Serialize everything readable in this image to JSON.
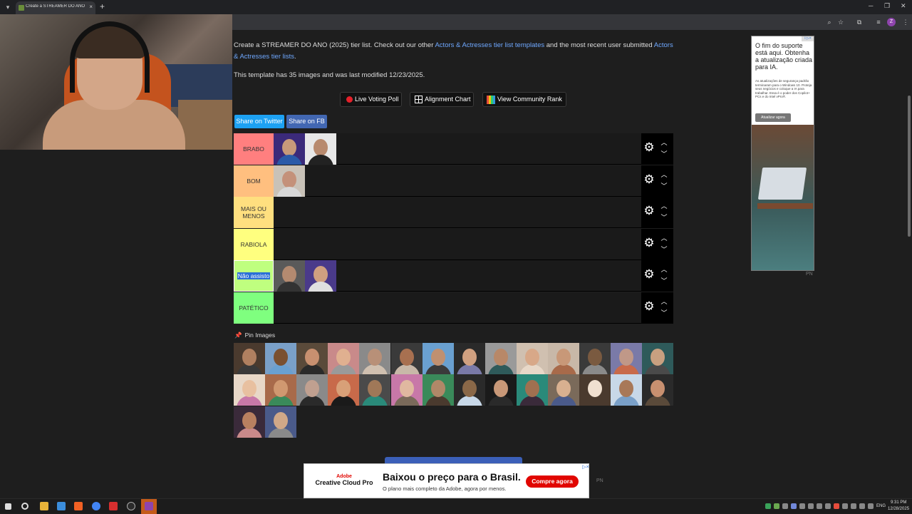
{
  "browser": {
    "tab_title": "Create a STREAMER DO ANO (2025)",
    "new_tab": "+",
    "close_tab": "×"
  },
  "page": {
    "intro_prefix": "Create a STREAMER DO ANO (2025) tier list. Check out our other ",
    "intro_link1": "Actors & Actresses tier list templates",
    "intro_mid": " and the most recent user submitted ",
    "intro_link2": "Actors & Actresses tier lists",
    "intro_suffix": ".",
    "meta": "This template has 35 images and was last modified 12/23/2025."
  },
  "buttons": {
    "live_poll": "Live Voting Poll",
    "alignment": "Alignment Chart",
    "community": "View Community Rank",
    "share_twitter": "Share on Twitter",
    "share_fb": "Share on FB"
  },
  "tiers": [
    {
      "label": "BRABO",
      "color": "#ff7f7f",
      "items": 2
    },
    {
      "label": "BOM",
      "color": "#ffbf7f",
      "items": 1
    },
    {
      "label": "MAIS OU MENOS",
      "color": "#ffdf7f",
      "items": 0
    },
    {
      "label": "RABIOLA",
      "color": "#ffff7f",
      "items": 0
    },
    {
      "label": "Não assisto",
      "color": "#bfff7f",
      "items": 2,
      "selected": true
    },
    {
      "label": "PATÉTICO",
      "color": "#7fff7f",
      "items": 0
    }
  ],
  "pin_label": "Pin Images",
  "pool_count": 30,
  "ad_side": {
    "headline": "O fim do suporte está aqui. Obtenha a atualização criada para IA.",
    "body": "As atualizações de segurança padrão terminaram para o Windows 10. Proteja seus negócios e coloque a IA para trabalhar. Essa é o poder dos Copilot+ PCs e do Intel vPro®.",
    "cta": "Atualizar agora",
    "adchoice": "i ▷×",
    "pn": "PN"
  },
  "ad_bottom": {
    "brand_logo": "Adobe",
    "brand_name": "Creative Cloud Pro",
    "title": "Baixou o preço para o Brasil.",
    "subtitle": "O plano mais completo da Adobe, agora por menos.",
    "cta": "Compre agora",
    "close": "▷×",
    "pn": "PN"
  },
  "taskbar": {
    "time": "9:31 PM",
    "date": "12/28/2025",
    "lang": "ENG"
  },
  "colors": {
    "twitter": "#1da1f2",
    "fb": "#4267b2",
    "link": "#6fa8ff"
  }
}
